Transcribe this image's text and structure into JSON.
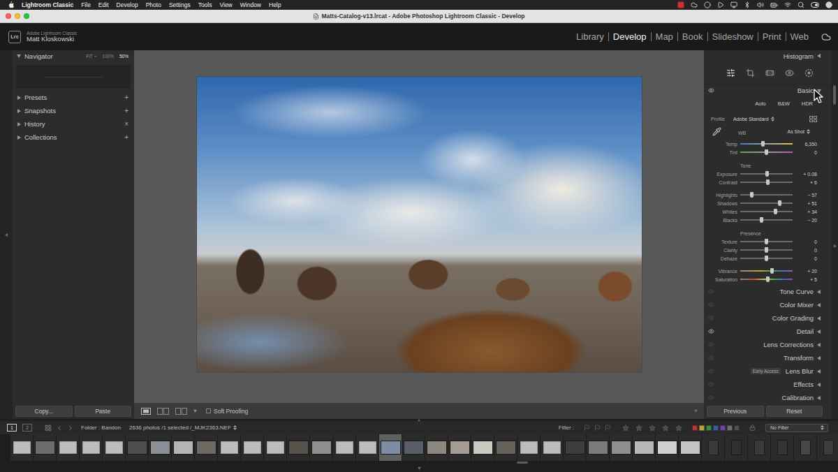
{
  "menu_bar": {
    "app": "Lightroom Classic",
    "items": [
      "File",
      "Edit",
      "Develop",
      "Photo",
      "Settings",
      "Tools",
      "View",
      "Window",
      "Help"
    ]
  },
  "window": {
    "title": "Matts-Catalog-v13.lrcat - Adobe Photoshop Lightroom Classic - Develop"
  },
  "identity_plate": {
    "logo": "Lrc",
    "product": "Adobe Lightroom Classic",
    "user": "Matt Kloskowski"
  },
  "modules": [
    {
      "label": "Library",
      "selected": false
    },
    {
      "label": "Develop",
      "selected": true
    },
    {
      "label": "Map",
      "selected": false
    },
    {
      "label": "Book",
      "selected": false
    },
    {
      "label": "Slideshow",
      "selected": false
    },
    {
      "label": "Print",
      "selected": false
    },
    {
      "label": "Web",
      "selected": false
    }
  ],
  "left_panel": {
    "navigator": {
      "title": "Navigator",
      "expanded": true,
      "zoom": [
        {
          "label": "FIT ÷",
          "selected": false
        },
        {
          "label": "100%",
          "selected": false
        },
        {
          "label": "50%",
          "selected": true
        }
      ]
    },
    "sections": [
      {
        "title": "Presets",
        "action": "+",
        "expanded": false
      },
      {
        "title": "Snapshots",
        "action": "+",
        "expanded": false
      },
      {
        "title": "History",
        "action": "×",
        "expanded": false
      },
      {
        "title": "Collections",
        "action": "+",
        "expanded": false
      }
    ],
    "buttons": [
      "Copy...",
      "Paste"
    ]
  },
  "center": {
    "toolbar": {
      "soft_proofing": {
        "label": "Soft Proofing",
        "checked": false
      }
    }
  },
  "right_panel": {
    "histogram": {
      "title": "Histogram",
      "expanded": false
    },
    "tools": [
      {
        "selected": true
      },
      {
        "selected": false
      },
      {
        "selected": false
      },
      {
        "selected": false
      },
      {
        "selected": false
      }
    ],
    "basic": {
      "title": "Basic",
      "expanded": true,
      "visible": true,
      "treatments": [
        "Auto",
        "B&W",
        "HDR"
      ],
      "profile": {
        "label": "Profile",
        "value": "Adobe Standard"
      },
      "wb": {
        "label": "WB",
        "value": "As Shot"
      },
      "wb_sliders": [
        {
          "label": "Temp",
          "value": "6,350",
          "level": 0.43,
          "kind": "temp"
        },
        {
          "label": "Tint",
          "value": "0",
          "level": 0.5,
          "kind": "tint"
        }
      ],
      "groups": [
        {
          "title": "Tone",
          "clusters": [
            [
              {
                "label": "Exposure",
                "value": "+ 0.08",
                "level": 0.51,
                "kind": "plain"
              },
              {
                "label": "Contrast",
                "value": "+ 6",
                "level": 0.53,
                "kind": "plain"
              }
            ],
            [
              {
                "label": "Highlights",
                "value": "− 57",
                "level": 0.22,
                "kind": "plain"
              },
              {
                "label": "Shadows",
                "value": "+ 51",
                "level": 0.75,
                "kind": "plain"
              },
              {
                "label": "Whites",
                "value": "+ 34",
                "level": 0.67,
                "kind": "plain"
              },
              {
                "label": "Blacks",
                "value": "− 20",
                "level": 0.4,
                "kind": "plain"
              }
            ]
          ]
        },
        {
          "title": "Presence",
          "clusters": [
            [
              {
                "label": "Texture",
                "value": "0",
                "level": 0.5,
                "kind": "plain"
              },
              {
                "label": "Clarity",
                "value": "0",
                "level": 0.5,
                "kind": "plain"
              },
              {
                "label": "Dehaze",
                "value": "0",
                "level": 0.5,
                "kind": "plain"
              }
            ],
            [
              {
                "label": "Vibrance",
                "value": "+ 20",
                "level": 0.6,
                "kind": "vibrance"
              },
              {
                "label": "Saturation",
                "value": "+ 5",
                "level": 0.53,
                "kind": "saturation"
              }
            ]
          ]
        }
      ]
    },
    "panels": [
      {
        "title": "Tone Curve",
        "visible": false,
        "expanded": false
      },
      {
        "title": "Color Mixer",
        "visible": false,
        "expanded": false
      },
      {
        "title": "Color Grading",
        "visible": false,
        "expanded": false
      },
      {
        "title": "Detail",
        "visible": true,
        "expanded": false
      },
      {
        "title": "Lens Corrections",
        "visible": false,
        "expanded": false
      },
      {
        "title": "Transform",
        "visible": false,
        "expanded": false
      },
      {
        "title": "Lens Blur",
        "badge": "Early Access",
        "visible": false,
        "expanded": false
      },
      {
        "title": "Effects",
        "visible": false,
        "expanded": false
      },
      {
        "title": "Calibration",
        "visible": false,
        "expanded": false
      }
    ],
    "buttons": [
      "Previous",
      "Reset"
    ]
  },
  "filmstrip": {
    "pages": [
      {
        "label": "1",
        "selected": true
      },
      {
        "label": "2",
        "selected": false
      }
    ],
    "source": "Folder : Bandon",
    "info": "2636 photos /1 selected /_MJK2363.NEF",
    "filter_label": "Filter :",
    "stars": 0,
    "labels": [
      {
        "color": "#b03a3a"
      },
      {
        "color": "#b8a53c"
      },
      {
        "color": "#3e8c3e"
      },
      {
        "color": "#3c5aa0"
      },
      {
        "color": "#6e46a0"
      },
      {
        "color": "#6f6f6f"
      },
      {
        "color": "#505050"
      }
    ],
    "preset": "No Filter",
    "scroll_position": 0.62,
    "thumbnails": [
      {
        "kind": "empty",
        "selected": false
      },
      {
        "kind": "landscape",
        "selected": false,
        "color": "#6c6c6c"
      },
      {
        "kind": "empty",
        "selected": false
      },
      {
        "kind": "empty",
        "selected": false
      },
      {
        "kind": "empty",
        "selected": false
      },
      {
        "kind": "landscape",
        "selected": false,
        "color": "#4f4f4f"
      },
      {
        "kind": "landscape",
        "selected": false,
        "color": "#8b9096"
      },
      {
        "kind": "landscape",
        "selected": false,
        "color": "#b4b4b2"
      },
      {
        "kind": "landscape",
        "selected": false,
        "color": "#6e6963"
      },
      {
        "kind": "empty",
        "selected": false
      },
      {
        "kind": "empty",
        "selected": false
      },
      {
        "kind": "empty",
        "selected": false
      },
      {
        "kind": "landscape",
        "selected": false,
        "color": "#57524c"
      },
      {
        "kind": "landscape",
        "selected": false,
        "color": "#8e8f90"
      },
      {
        "kind": "empty",
        "selected": false
      },
      {
        "kind": "empty",
        "selected": false
      },
      {
        "kind": "landscape",
        "selected": true,
        "color": "#7d8ea4"
      },
      {
        "kind": "landscape",
        "selected": false,
        "color": "#5a5e66"
      },
      {
        "kind": "landscape",
        "selected": false,
        "color": "#8c8881"
      },
      {
        "kind": "landscape",
        "selected": false,
        "color": "#a29c94"
      },
      {
        "kind": "landscape",
        "selected": false,
        "color": "#cbc7c1"
      },
      {
        "kind": "landscape",
        "selected": false,
        "color": "#67625c"
      },
      {
        "kind": "empty",
        "selected": false
      },
      {
        "kind": "empty",
        "selected": false
      },
      {
        "kind": "landscape",
        "selected": false,
        "color": "#3d3d3d"
      },
      {
        "kind": "landscape",
        "selected": false,
        "color": "#7a7a7a"
      },
      {
        "kind": "landscape",
        "selected": false,
        "color": "#8f8f8f"
      },
      {
        "kind": "landscape",
        "selected": false,
        "color": "#b8b8b8"
      },
      {
        "kind": "landscape",
        "selected": false,
        "color": "#d0d0d0"
      },
      {
        "kind": "landscape",
        "selected": false,
        "color": "#c4c4c4"
      },
      {
        "kind": "portrait",
        "selected": false,
        "color": "#3b3b3b"
      },
      {
        "kind": "portrait",
        "selected": false,
        "color": "#2f2f2f"
      },
      {
        "kind": "portrait",
        "selected": false,
        "color": "#3a3a3a"
      },
      {
        "kind": "portrait",
        "selected": false,
        "color": "#343434"
      },
      {
        "kind": "portrait",
        "selected": false,
        "color": "#474747"
      },
      {
        "kind": "portrait",
        "selected": false,
        "color": "#3c3c3c"
      }
    ]
  }
}
